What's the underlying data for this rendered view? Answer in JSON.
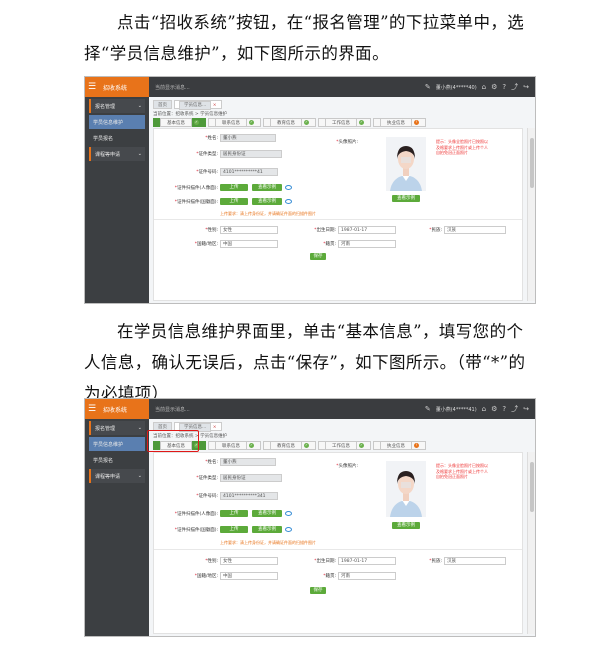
{
  "paragraphs": {
    "p1": "点击“招收系统”按钮，在“报名管理”的下拉菜单中，选择“学员信息维护”，如下图所示的界面。",
    "p2": "在学员信息维护界面里，单击“基本信息”，填写您的个人信息，确认无误后，点击“保存”，如下图所示。（带“*”的为必填项）"
  },
  "app": {
    "brand": "招收系统",
    "notice": "当前显示消息...",
    "user_a": "董小燕(4*****40)",
    "user_b": "董小燕(4*****41)",
    "sidebar": [
      "报名管理",
      "学员信息维护",
      "学员报名",
      "课程等申请"
    ],
    "page_tab": "学员信息...",
    "breadcrumb": "当前位置：招收系统 > 学员信息维护",
    "form_tabs": [
      "基本信息",
      "联系信息",
      "教育信息",
      "工作信息",
      "执业信息"
    ],
    "labels": {
      "name": "姓名:",
      "idtype": "证件类型:",
      "idno": "证件号码:",
      "scan1": "证件扫描件(人像面):",
      "scan2": "证件扫描件(国徽面):",
      "photo": "头像照片:",
      "gender": "性别:",
      "birthday": "出生日期:",
      "nation": "民族:",
      "region": "国籍/地区:",
      "origin": "籍贯:"
    },
    "values": {
      "name": "董小燕",
      "idtype": "居民身份证",
      "idno_a": "4101**********41",
      "idno_b": "4101**********341",
      "gender": "女性",
      "birthday": "1987-01-17",
      "nation": "汉族",
      "region": "中国",
      "origin": "河南"
    },
    "buttons": {
      "upload": "上传",
      "view_example": "查看示例",
      "view_sample_photo": "查看示例",
      "save": "保存"
    },
    "upload_hint": "上传要求：清上传身份证，并请确证件面的扫描件图片",
    "photo_tip": "提示：头像全脸照片已按照以及格要求上传照片或上传个人自拍免冠正面照片"
  },
  "colors": {
    "accent": "#e8731a",
    "green": "#5caa3a",
    "dark": "#3a3c3f",
    "highlight": "#e01818"
  }
}
